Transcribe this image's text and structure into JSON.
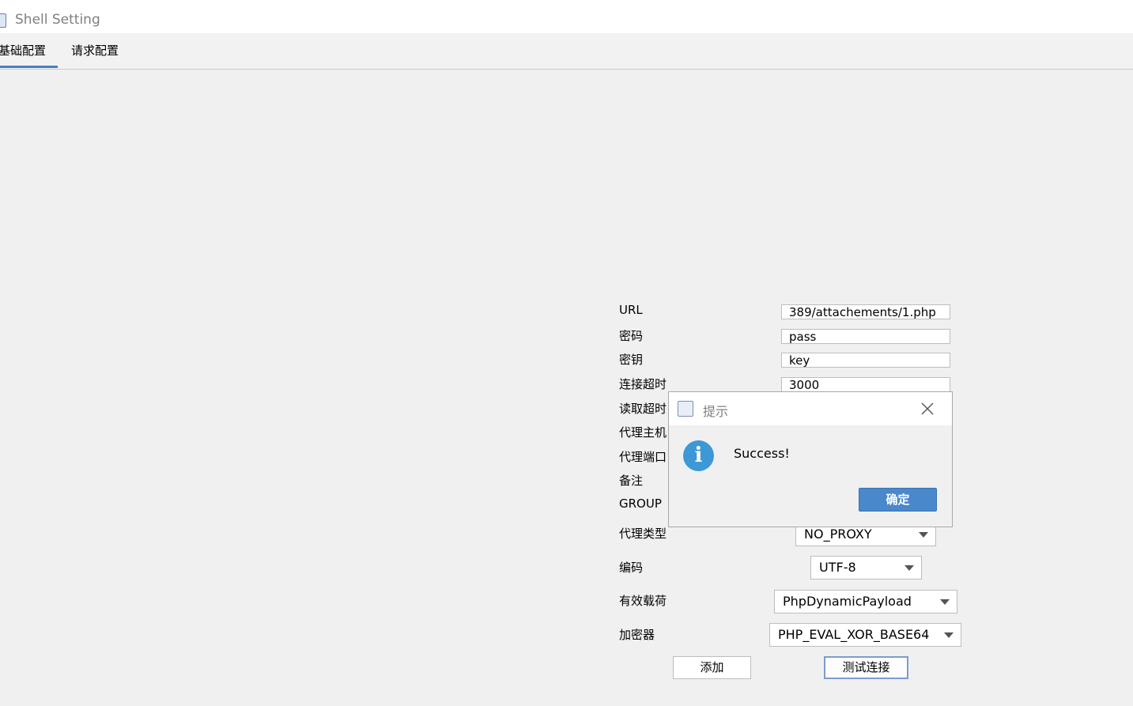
{
  "window": {
    "title": "Shell Setting"
  },
  "tabs": [
    {
      "label": "基础配置",
      "active": true
    },
    {
      "label": "请求配置",
      "active": false
    }
  ],
  "form": {
    "labels": {
      "url": "URL",
      "password": "密码",
      "key": "密钥",
      "connect_timeout": "连接超时",
      "read_timeout": "读取超时",
      "proxy_host": "代理主机",
      "proxy_port": "代理端口",
      "remark": "备注",
      "group": "GROUP",
      "proxy_type": "代理类型",
      "encoding": "编码",
      "payload": "有效载荷",
      "cryption": "加密器"
    },
    "values": {
      "url": "389/attachements/1.php",
      "password": "pass",
      "key": "key",
      "connect_timeout": "3000",
      "proxy_type": "NO_PROXY",
      "encoding": "UTF-8",
      "payload": "PhpDynamicPayload",
      "cryption": "PHP_EVAL_XOR_BASE64"
    },
    "buttons": {
      "add": "添加",
      "test": "测试连接"
    }
  },
  "dialog": {
    "title": "提示",
    "message": "Success!",
    "ok_label": "确定",
    "icon": "info-icon",
    "accent_color": "#4a88cc"
  }
}
